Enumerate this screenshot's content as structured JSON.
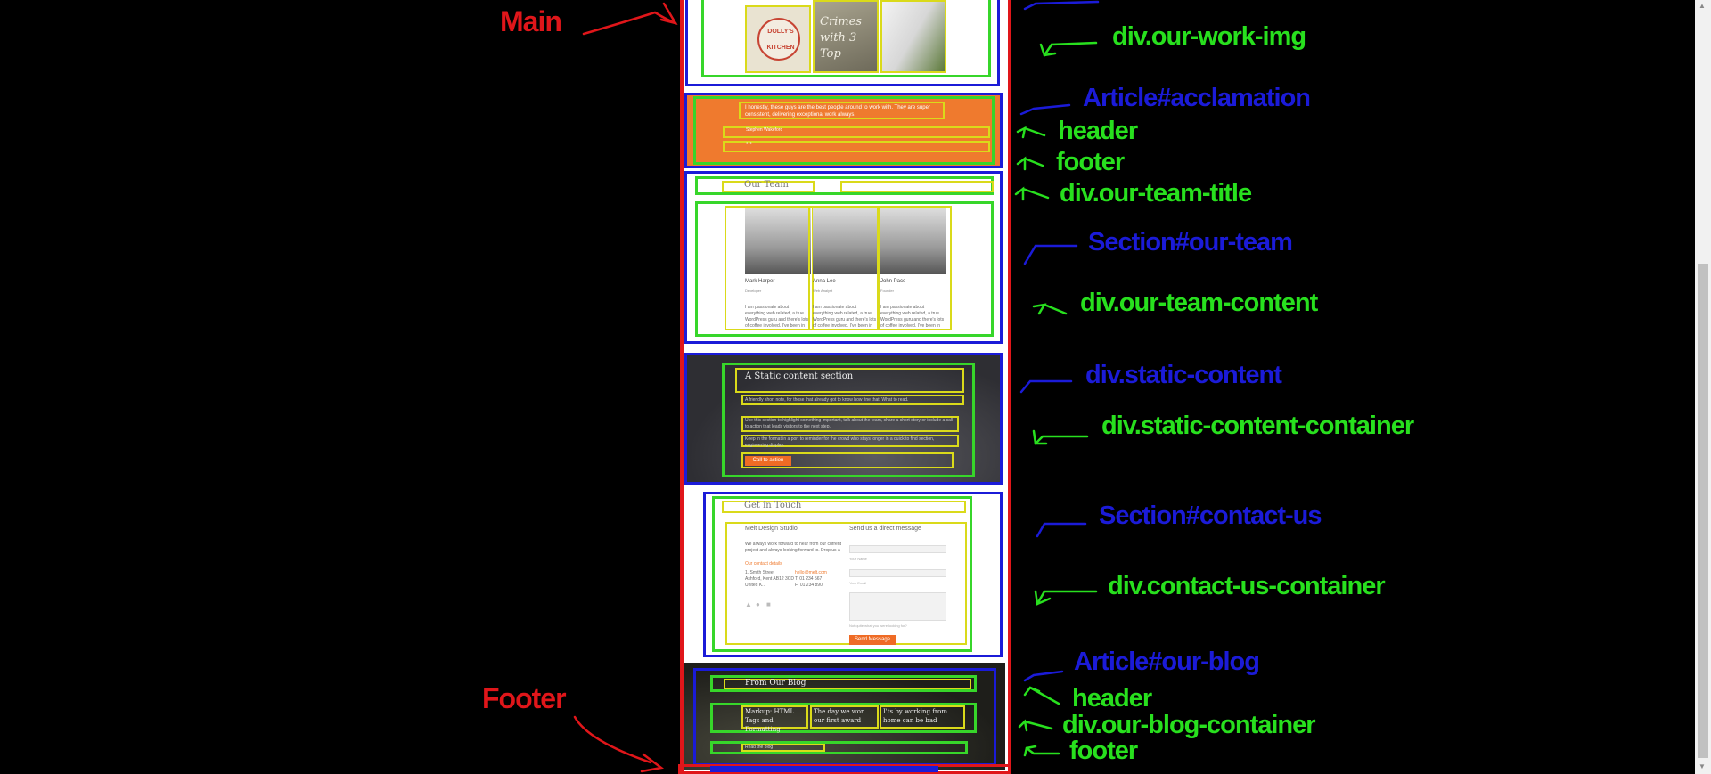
{
  "annotations": {
    "main": "Main",
    "footer": "Footer",
    "our_work_img": "div.our-work-img",
    "acclamation": "Article#acclamation",
    "acclamation_header": "header",
    "acclamation_footer": "footer",
    "our_team_title": "div.our-team-title",
    "our_team_section": "Section#our-team",
    "our_team_content": "div.our-team-content",
    "static_content": "div.static-content",
    "static_content_container": "div.static-content-container",
    "contact_us": "Section#contact-us",
    "contact_us_container": "div.contact-us-container",
    "our_blog": "Article#our-blog",
    "blog_header": "header",
    "blog_container": "div.our-blog-container",
    "blog_footer": "footer"
  },
  "work": {
    "tile1_line1": "DOLLY'S",
    "tile1_line2": "KITCHEN",
    "tile2_text": "Crimes with 3 Top"
  },
  "acclamation": {
    "quote": "I honestly, these guys are the best people around to work with. They are super consistent, delivering exceptional work always.",
    "author": "Stephen Wakeford",
    "dots": "• •"
  },
  "team": {
    "title": "Our Team",
    "members": [
      {
        "name": "Mark Harper",
        "role": "Developer",
        "bio": "I am passionate about everything web related, a true WordPress guru and there's lots of coffee involved. I've been in the industry a long time."
      },
      {
        "name": "Anna Lee",
        "role": "Web Analyst",
        "bio": "I am passionate about everything web related, a true WordPress guru and there's lots of coffee involved. I've been in the industry a long time."
      },
      {
        "name": "John Pace",
        "role": "Founder",
        "bio": "I am passionate about everything web related, a true WordPress guru and there's lots of coffee involved. I've been in the industry a long time."
      }
    ]
  },
  "static": {
    "title": "A Static content section",
    "p1": "A friendly short note, for those that already got to know how fine that. What to read.",
    "p2": "Use this section to highlight something important, talk about the team, share a short story or include a call to action that leads visitors to the next step.",
    "p3": "Keep in the format in a port to reminder for the crowd who stays longer in a quick to find section, engineering display.",
    "button": "Call to action"
  },
  "contact": {
    "title": "Get in Touch",
    "company": "Melt Design Studio",
    "about": "We always work forward to hear from our current project and always looking forward to. Drop us a line if you have a great idea to start.",
    "details_title": "Our contact details",
    "address": [
      "1, Smith Street",
      "Ashford, Kent AB12 3CD",
      "United K..."
    ],
    "phones": [
      "hello@melt.com",
      "T: 01 234 567",
      "F: 01 234 890"
    ],
    "form_title": "Send us a direct message",
    "name_ph": "Your Name",
    "email_ph": "Your Email",
    "message_ph": "Your Message",
    "note": "Not quite what you were looking for?",
    "send": "Send Message"
  },
  "blog": {
    "title": "From Our Blog",
    "posts": [
      "Markup: HTML Tags and Formatting",
      "The day we won our first award",
      "I'ts by working from home can be bad"
    ],
    "footer_link": "Read the blog"
  },
  "colors": {
    "blue": "#1b1bd8",
    "green": "#37d62a",
    "yellow": "#dada1a",
    "red": "#e0161a",
    "orange": "#ef7a2e"
  }
}
